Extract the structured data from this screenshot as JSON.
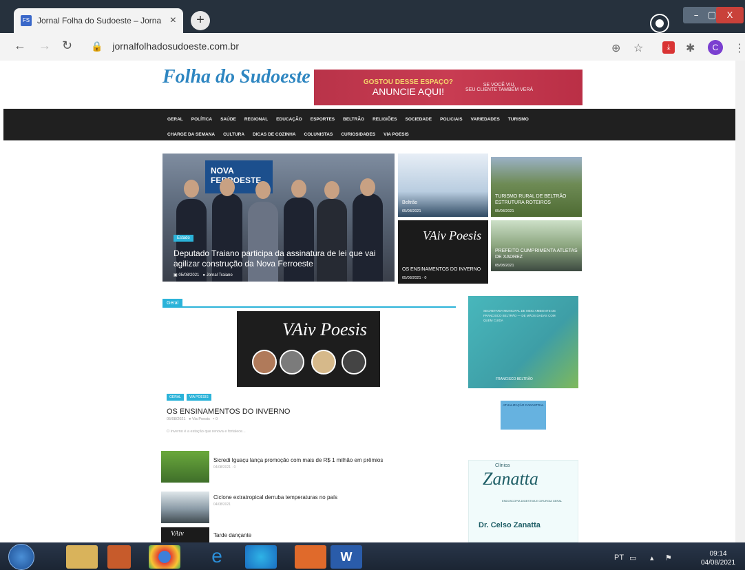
{
  "browser": {
    "tab_title": "Jornal Folha do Sudoeste – Jorna",
    "tab_favicon": "FS",
    "new_tab": "+",
    "url": "jornalfolhadosudoeste.com.br",
    "profile_letter": "C",
    "window_controls": [
      "–",
      "▢",
      "X"
    ]
  },
  "site": {
    "logo": "Folha do Sudoeste",
    "banner": {
      "line1": "GOSTOU DESSE ESPAÇO?",
      "line2": "ANUNCIE AQUI!",
      "side1": "SE VOCÊ VIU,",
      "side2": "SEU CLIENTE TAMBÉM VERÁ"
    },
    "nav_row1": [
      "GERAL",
      "POLÍTICA",
      "SAÚDE",
      "REGIONAL",
      "EDUCAÇÃO",
      "ESPORTES",
      "BELTRÃO",
      "RELIGIÕES",
      "SOCIEDADE",
      "POLICIAIS",
      "VARIEDADES",
      "TURISMO"
    ],
    "nav_row2": [
      "CHARGE DA SEMANA",
      "CULTURA",
      "DICAS DE COZINHA",
      "COLUNISTAS",
      "CURIOSIDADES",
      "VIA POESIS"
    ],
    "hero": {
      "screen_text": "NOVA FERROESTE",
      "category": "Estado",
      "title": "Deputado Traiano participa da assinatura de lei que vai agilizar construção da Nova Ferroeste",
      "date": "05/08/2021",
      "author": "Jornal Traiano"
    },
    "tiles": [
      {
        "caption": "Beltrão",
        "date": "05/08/2021"
      },
      {
        "caption": "TURISMO RURAL DE BELTRÃO ESTRUTURA ROTEIROS",
        "date": "05/08/2021"
      },
      {
        "caption": "OS ENSINAMENTOS DO INVERNO",
        "date": "05/08/2021",
        "comments": "0",
        "logo": "VAiv Poesis"
      },
      {
        "caption": "PREFEITO CUMPRIMENTA ATLETAS DE XADREZ",
        "date": "05/08/2021"
      }
    ],
    "section_label": "Geral",
    "feature": {
      "logo": "VAiv Poesis",
      "categories": [
        "GERAL",
        "VIA POESIS"
      ],
      "title": "OS ENSINAMENTOS DO INVERNO",
      "date": "05/08/2021",
      "author": "Via Poesis",
      "comments": "0",
      "excerpt": "O inverno é a estação que renova e fortalece..."
    },
    "list": [
      {
        "title": "Sicredi Iguaçu lança promoção com mais de R$ 1 milhão em prêmios",
        "date": "04/08/2021",
        "comments": "0"
      },
      {
        "title": "Ciclone extratropical derruba temperaturas no país",
        "date": "04/08/2021"
      },
      {
        "title": "Tarde dançante",
        "logo": "VAiv"
      }
    ],
    "side_ads": {
      "ad1_text": "SECRETARIA MUNICIPAL DE MEIO AMBIENTE DE FRANCISCO BELTRÃO — DE MÃOS DADAS COM QUEM CUIDA",
      "ad1_org": "FRANCISCO BELTRÃO",
      "ad2_text": "ATUALIZAÇÃO CADASTRAL",
      "ad3_clinic": "Clínica",
      "ad3_name": "Zanatta",
      "ad3_sub": "ENDOSCOPIA DIGESTIVA E CIRURGIA GERAL",
      "ad3_doctor": "Dr. Celso Zanatta"
    }
  },
  "taskbar": {
    "lang": "PT",
    "time": "09:14",
    "date": "04/08/2021",
    "word_label": "W"
  }
}
